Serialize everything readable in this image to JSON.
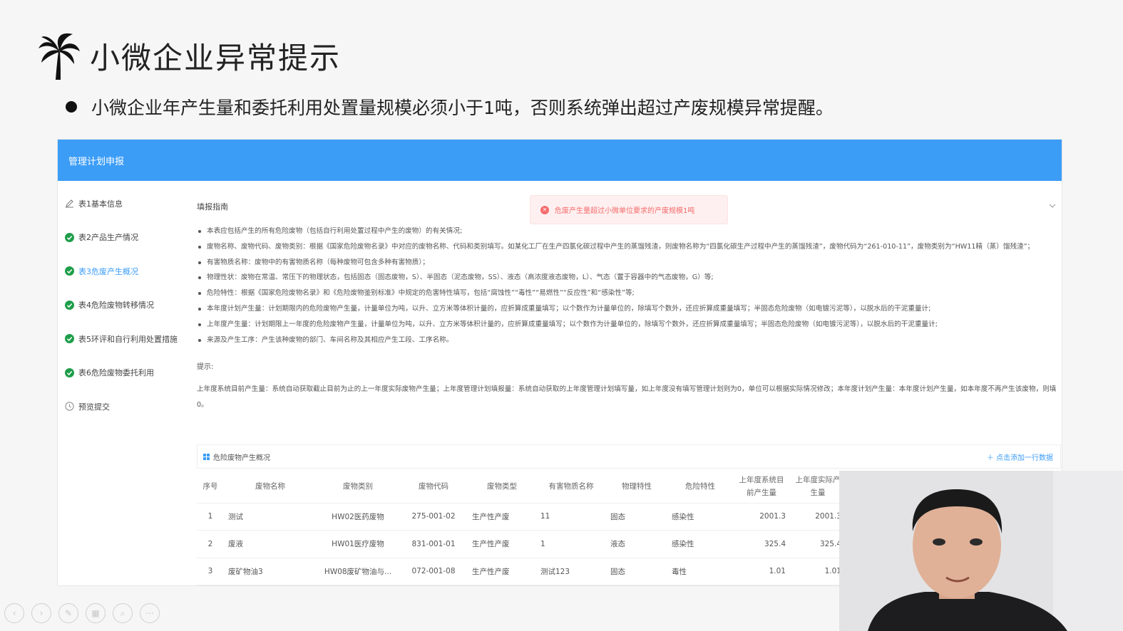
{
  "slide": {
    "title": "小微企业异常提示",
    "bullet": "小微企业年产生量和委托利用处置量规模必须小于1吨，否则系统弹出超过产废规模异常提醒。"
  },
  "app": {
    "header_title": "管理计划申报",
    "sidebar": [
      {
        "label": "表1基本信息",
        "status": "edit"
      },
      {
        "label": "表2产品生产情况",
        "status": "done"
      },
      {
        "label": "表3危废产生概况",
        "status": "done-active"
      },
      {
        "label": "表4危险废物转移情况",
        "status": "done"
      },
      {
        "label": "表5环评和自行利用处置措施",
        "status": "done"
      },
      {
        "label": "表6危险废物委托利用",
        "status": "done"
      },
      {
        "label": "预览提交",
        "status": "pending"
      }
    ],
    "guide_title": "填报指南",
    "error_message": "危废产生量超过小微单位要求的产废规模1吨",
    "guide_items": [
      "本表应包括产生的所有危险废物（包括自行利用处置过程中产生的废物）的有关情况;",
      "废物名称、废物代码、废物类别：根据《国家危险废物名录》中对应的废物名称、代码和类别填写。如某化工厂在生产四氯化碳过程中产生的蒸馏残渣，则废物名称为“四氯化碳生产过程中产生的蒸馏残渣”，废物代码为“261-010-11”，废物类别为“HW11精（蒸）馏残渣”；",
      "有害物质名称：废物中的有害物质名称（每种废物可包含多种有害物质）；",
      "物理性状：废物在常温、常压下的物理状态，包括固态（固态废物，S）、半固态（泥态废物，SS）、液态（高浓度液态废物，L）、气态（置于容器中的气态废物，G）等;",
      "危险特性：根据《国家危险废物名录》和《危险废物鉴别标准》中规定的危害特性填写，包括“腐蚀性”“毒性”“易燃性”“反应性”和“感染性”等;",
      "本年度计划产生量：计划期限内的危险废物产生量，计量单位为吨，以升、立方米等体积计量的，应折算成重量填写；以个数作为计量单位的，除填写个数外，还应折算成重量填写；半固态危险废物（如电镀污泥等），以脱水后的干泥重量计;",
      "上年度产生量：计划期限上一年度的危险废物产生量，计量单位为吨，以升、立方米等体积计量的，应折算成重量填写；以个数作为计量单位的，除填写个数外，还应折算成重量填写；半固态危险废物（如电镀污泥等），以脱水后的干泥重量计;",
      "来源及产生工序：产生该种废物的部门、车间名称及其相应产生工段、工序名称。"
    ],
    "tip_label": "提示:",
    "tip_text": "上年度系统目前产生量：系统自动获取截止目前为止的上一年度实际废物产生量；上年度管理计划填报量：系统自动获取的上年度管理计划填写量，如上年度没有填写管理计划则为0，单位可以根据实际情况修改；本年度计划产生量：本年度计划产生量，如本年度不再产生该废物，则填0。",
    "section_title": "危险废物产生概况",
    "add_row_label": "点击添加一行数据",
    "table": {
      "headers": [
        "序号",
        "废物名称",
        "废物类别",
        "废物代码",
        "废物类型",
        "有害物质名称",
        "物理特性",
        "危险特性",
        "上年度系统目前产生量",
        "上年度实际产生量"
      ],
      "rows": [
        [
          "1",
          "测试",
          "HW02医药废物",
          "275-001-02",
          "生产性产废",
          "11",
          "固态",
          "感染性",
          "2001.3",
          "2001.3"
        ],
        [
          "2",
          "废液",
          "HW01医疗废物",
          "831-001-01",
          "生产性产废",
          "1",
          "液态",
          "感染性",
          "325.4",
          "325.4"
        ],
        [
          "3",
          "废矿物油3",
          "HW08废矿物油与...",
          "072-001-08",
          "生产性产废",
          "测试123",
          "固态",
          "毒性",
          "1.01",
          "1.01"
        ]
      ]
    }
  },
  "icons": [
    "palm-tree-icon",
    "edit-icon",
    "check-circle-icon",
    "clock-icon",
    "error-circle-icon",
    "chevron-down-icon",
    "grid-icon",
    "plus-icon"
  ],
  "colors": {
    "primary": "#3c9df7",
    "success": "#1e9e4a",
    "error": "#f56c6c"
  }
}
